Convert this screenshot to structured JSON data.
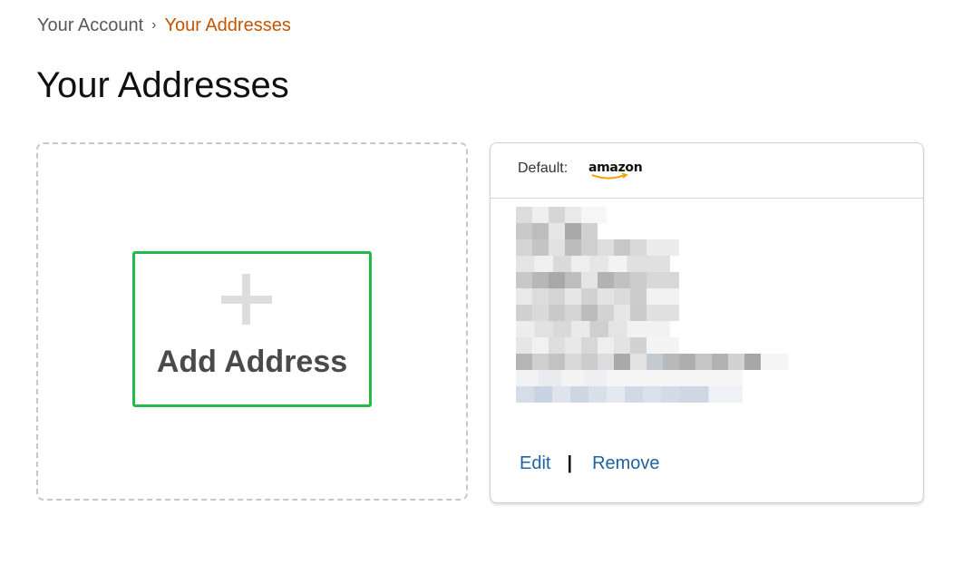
{
  "breadcrumb": {
    "parent": "Your Account",
    "separator": "›",
    "current": "Your Addresses"
  },
  "page": {
    "title": "Your Addresses"
  },
  "add_tile": {
    "label": "Add Address",
    "icon": "plus-icon"
  },
  "address_card": {
    "default_label": "Default:",
    "brand_logo": "amazon",
    "address_content": "redacted",
    "actions": {
      "edit": "Edit",
      "separator": "|",
      "remove": "Remove"
    }
  },
  "colors": {
    "breadcrumb_current": "#c45500",
    "link": "#2162a1",
    "focus_outline": "#25b84a",
    "amazon_smile": "#ff9900"
  }
}
